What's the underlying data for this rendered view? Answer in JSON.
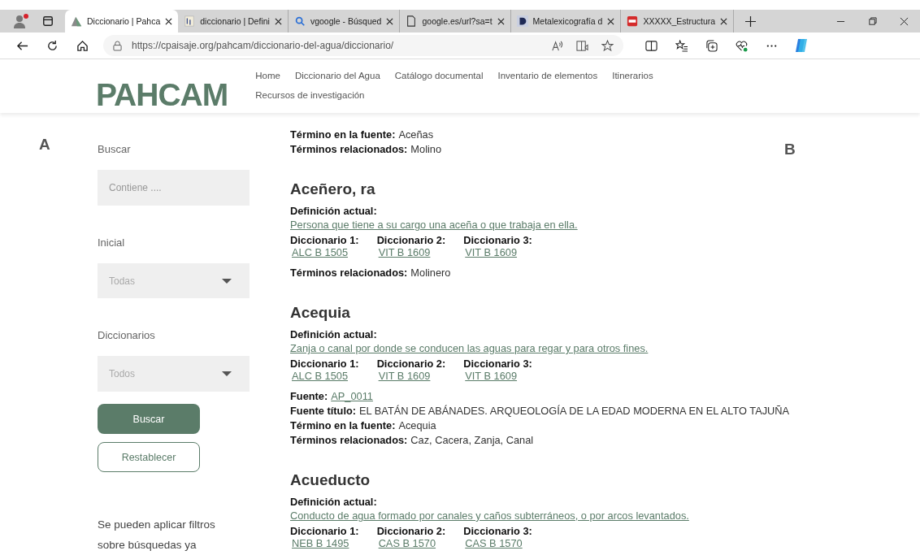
{
  "browser": {
    "tabs": [
      {
        "title": "Diccionario | Pahca",
        "selected": true
      },
      {
        "title": "diccionario | Defini",
        "selected": false
      },
      {
        "title": "vgoogle - Búsqued",
        "selected": false
      },
      {
        "title": "google.es/url?sa=t",
        "selected": false
      },
      {
        "title": "Metalexicografía d",
        "selected": false
      },
      {
        "title": "XXXXX_Estructura",
        "selected": false
      }
    ],
    "url": "https://cpaisaje.org/pahcam/diccionario-del-agua/diccionario/"
  },
  "site": {
    "logo": "PAHCAM",
    "nav": [
      "Home",
      "Diccionario del Agua",
      "Catálogo documental",
      "Inventario de elementos",
      "Itinerarios",
      "Recursos de investigación"
    ]
  },
  "markers": [
    "A",
    "B"
  ],
  "filters": {
    "search_label": "Buscar",
    "search_placeholder": "Contiene ....",
    "selects": [
      {
        "label": "Inicial",
        "value": "Todas"
      },
      {
        "label": "Diccionarios",
        "value": "Todos"
      }
    ],
    "buttons": [
      {
        "label": "Buscar",
        "kind": "primary"
      },
      {
        "label": "Restablecer",
        "kind": "outline"
      }
    ],
    "help": "Se pueden aplicar filtros sobre búsquedas ya"
  },
  "entries": [
    {
      "after": [
        {
          "label": "Término en la fuente:",
          "value": "Aceñas",
          "kind": "text"
        },
        {
          "label": "Términos relacionados:",
          "value": "Molino",
          "kind": "text"
        }
      ]
    },
    {
      "term": "Aceñero, ra",
      "definition_label": "Definición actual:",
      "definition": "Persona que tiene a su cargo una aceña o que trabaja en ella.",
      "dictionaries": [
        {
          "label": "Diccionario 1:",
          "code": "ALC B 1505"
        },
        {
          "label": "Diccionario 2:",
          "code": "VIT B 1609"
        },
        {
          "label": "Diccionario 3:",
          "code": "VIT B 1609"
        }
      ],
      "after": [
        {
          "label": "Términos relacionados:",
          "value": "Molinero",
          "kind": "text"
        }
      ]
    },
    {
      "term": "Acequia",
      "definition_label": "Definición actual:",
      "definition": "Zanja o canal por donde se conducen las aguas para regar y para otros fines.",
      "dictionaries": [
        {
          "label": "Diccionario 1:",
          "code": "ALC B 1505"
        },
        {
          "label": "Diccionario 2:",
          "code": "VIT B 1609"
        },
        {
          "label": "Diccionario 3:",
          "code": "VIT B 1609"
        }
      ],
      "after": [
        {
          "label": "Fuente:",
          "value": "AP_0011",
          "kind": "link"
        },
        {
          "label": "Fuente título:",
          "value": "EL BATÁN DE ABÁNADES. ARQUEOLOGÍA DE LA EDAD MODERNA EN EL ALTO TAJUÑA",
          "kind": "text"
        },
        {
          "label": "Término en la fuente:",
          "value": "Acequia",
          "kind": "text"
        },
        {
          "label": "Términos relacionados:",
          "value": "Caz, Cacera, Zanja, Canal",
          "kind": "text"
        }
      ]
    },
    {
      "term": "Acueducto",
      "definition_label": "Definición actual:",
      "definition": "Conducto de agua formado por canales y caños subterráneos, o por arcos levantados.",
      "dictionaries": [
        {
          "label": "Diccionario 1:",
          "code": "NEB B 1495"
        },
        {
          "label": "Diccionario 2:",
          "code": "CAS B 1570"
        },
        {
          "label": "Diccionario 3:",
          "code": "CAS B 1570"
        }
      ]
    }
  ]
}
